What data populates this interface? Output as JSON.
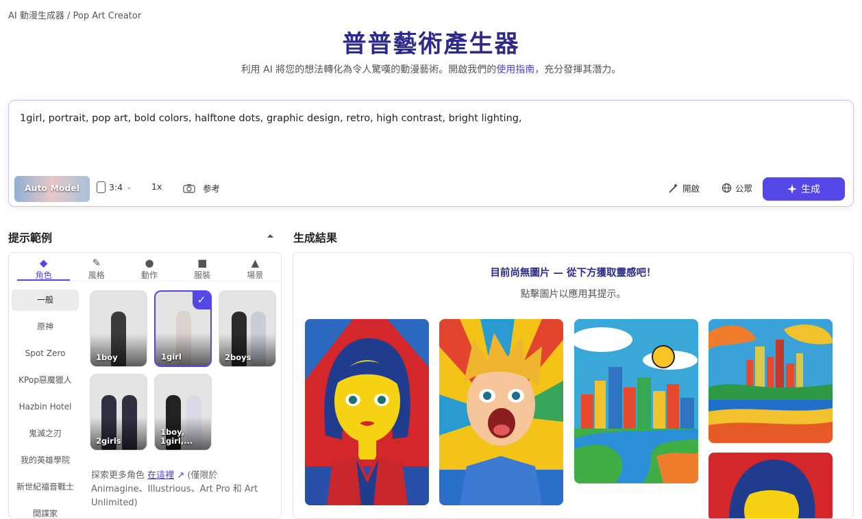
{
  "breadcrumb": "AI 動漫生成器 / Pop Art Creator",
  "title": "普普藝術產生器",
  "subtitle_pre": "利用 AI 將您的想法轉化為令人驚嘆的動漫藝術。開啟我們的",
  "subtitle_link": "使用指南",
  "subtitle_post": "，充分發揮其潛力。",
  "prompt": "1girl, portrait, pop art, bold colors, halftone dots, graphic design, retro, high contrast, bright lighting,",
  "toolbar": {
    "model": "Auto Model",
    "ratio": "3:4",
    "count": "1x",
    "reference": "参考",
    "open": "開啟",
    "public": "公眾",
    "generate": "生成"
  },
  "examples_title": "提示範例",
  "results_title": "生成結果",
  "tabs": [
    {
      "icon": "mask-icon",
      "label": "角色"
    },
    {
      "icon": "brush-icon",
      "label": "風格"
    },
    {
      "icon": "person-icon",
      "label": "動作"
    },
    {
      "icon": "shirt-icon",
      "label": "服裝"
    },
    {
      "icon": "landscape-icon",
      "label": "場景"
    }
  ],
  "categories": [
    "一般",
    "原神",
    "Spot Zero",
    "KPop惡魔獵人",
    "Hazbin Hotel",
    "鬼滅之刃",
    "我的英雄學院",
    "新世紀福音戰士",
    "間諜家"
  ],
  "cards": [
    "1boy",
    "1girl",
    "2boys",
    "2girls",
    "1boy, 1girl,..."
  ],
  "explore_pre": "探索更多角色",
  "explore_link": "在這裡",
  "explore_post": "(僅限於 Animagine、Illustrious、Art Pro 和 Art Unlimited)",
  "results_empty": "目前尚無圖片 — 從下方獲取靈感吧！",
  "results_hint": "點擊圖片以應用其提示。",
  "colors": {
    "accent": "#5546e8",
    "title": "#2e2a8a"
  }
}
